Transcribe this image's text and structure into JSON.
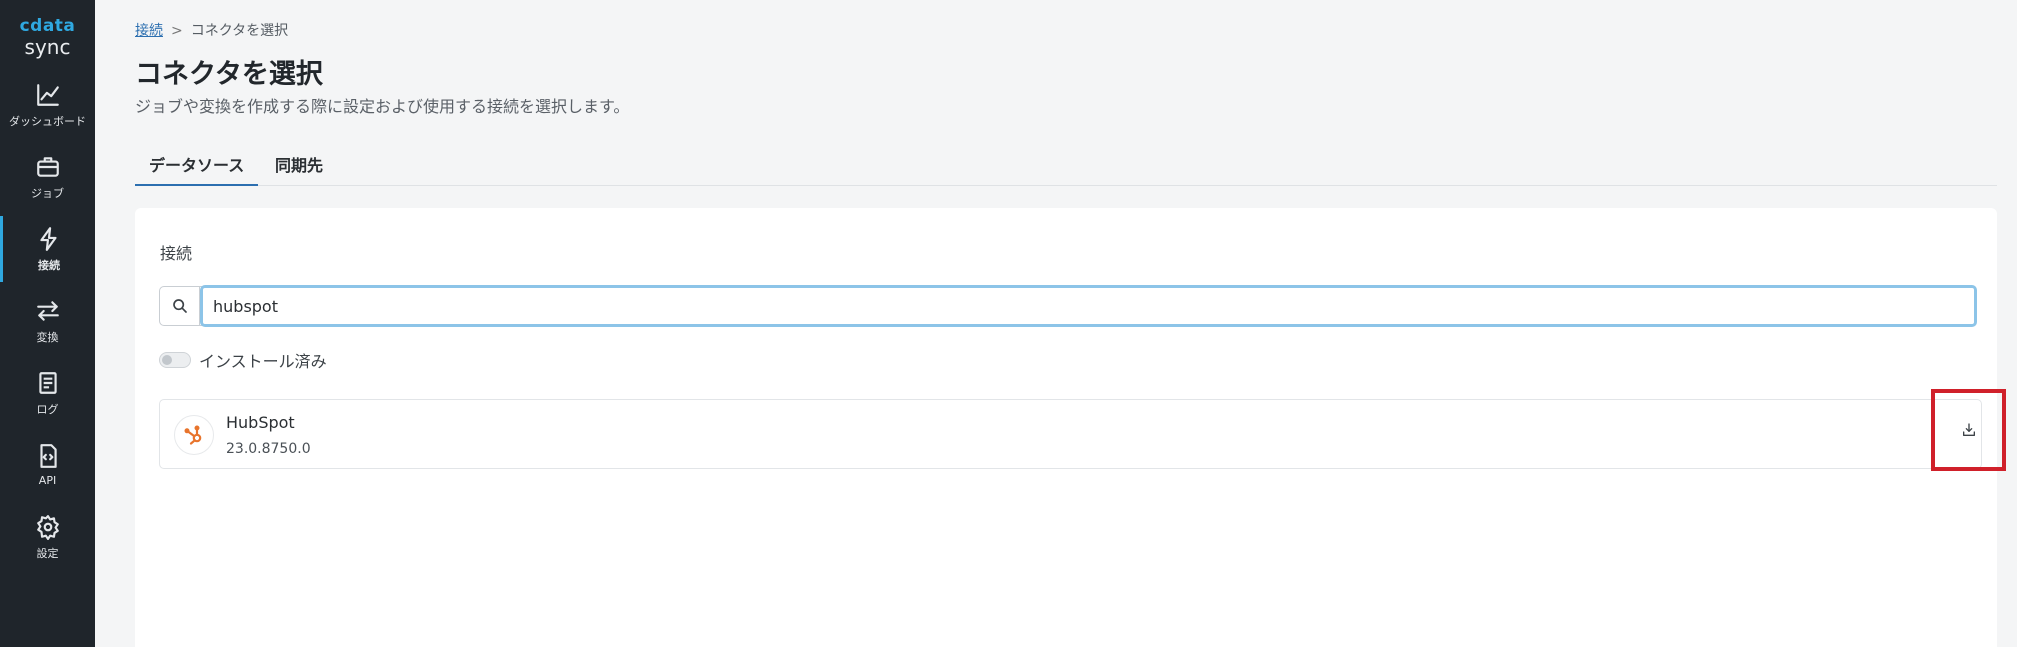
{
  "sidebar": {
    "logo_text": "cdata",
    "logo_sub": "sync",
    "items": [
      {
        "label": "ダッシュボード",
        "icon": "chart-line-icon"
      },
      {
        "label": "ジョブ",
        "icon": "briefcase-icon"
      },
      {
        "label": "接続",
        "icon": "lightning-icon"
      },
      {
        "label": "変換",
        "icon": "swap-arrows-icon"
      },
      {
        "label": "ログ",
        "icon": "book-icon"
      },
      {
        "label": "API",
        "icon": "code-file-icon"
      },
      {
        "label": "設定",
        "icon": "gear-icon"
      }
    ],
    "active_index": 2
  },
  "breadcrumb": {
    "link": "接続",
    "separator": ">",
    "current": "コネクタを選択"
  },
  "page": {
    "title": "コネクタを選択",
    "description": "ジョブや変換を作成する際に設定および使用する接続を選択します。"
  },
  "tabs": [
    {
      "label": "データソース",
      "active": true
    },
    {
      "label": "同期先",
      "active": false
    }
  ],
  "card": {
    "section_label": "接続",
    "search_value": "hubspot",
    "toggle_label": "インストール済み",
    "toggle_on": false,
    "connectors": [
      {
        "name": "HubSpot",
        "version": "23.0.8750.0",
        "icon": "hubspot-icon",
        "action_icon": "download-icon"
      }
    ]
  },
  "colors": {
    "accent": "#2c6fb0",
    "sidebar_bg": "#1f252b",
    "logo": "#2fa8e0",
    "highlight": "#d0202a",
    "hubspot": "#e8742c"
  }
}
